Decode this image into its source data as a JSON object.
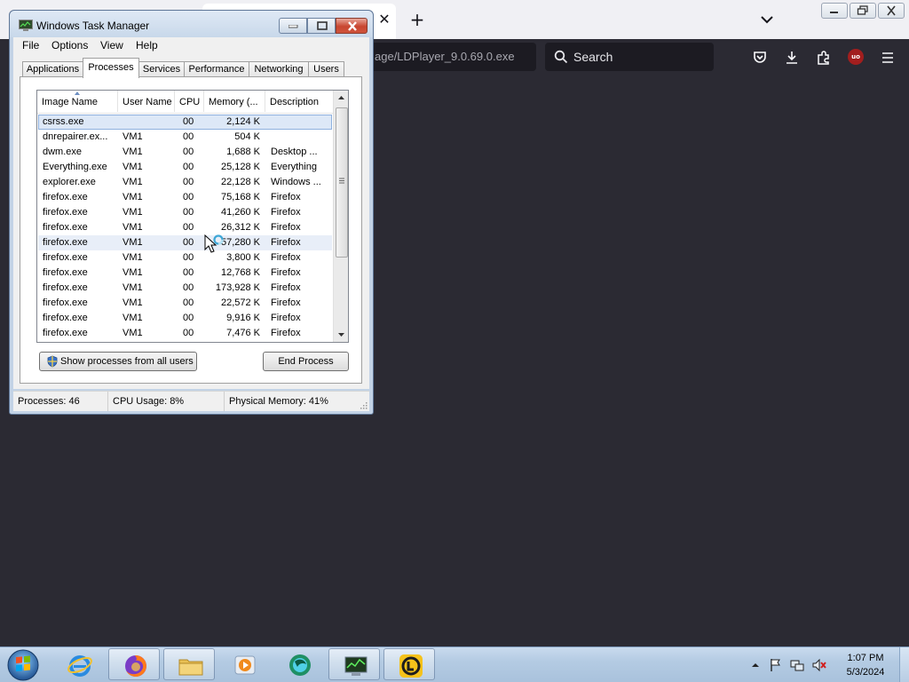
{
  "browser": {
    "tab_close_glyph": "✕",
    "new_tab_glyph": "+",
    "url_text": "age/LDPlayer_9.0.69.0.exe",
    "search_placeholder": "Search",
    "ublock_badge": "uo",
    "accent_bg": "#2b2a33"
  },
  "task_manager": {
    "title": "Windows Task Manager",
    "menu": [
      "File",
      "Options",
      "View",
      "Help"
    ],
    "tabs": [
      "Applications",
      "Processes",
      "Services",
      "Performance",
      "Networking",
      "Users"
    ],
    "active_tab": "Processes",
    "columns": [
      "Image Name",
      "User Name",
      "CPU",
      "Memory (...",
      "Description"
    ],
    "processes": [
      {
        "name": "csrss.exe",
        "user": "",
        "cpu": "00",
        "mem": "2,124 K",
        "desc": ""
      },
      {
        "name": "dnrepairer.ex...",
        "user": "VM1",
        "cpu": "00",
        "mem": "504 K",
        "desc": ""
      },
      {
        "name": "dwm.exe",
        "user": "VM1",
        "cpu": "00",
        "mem": "1,688 K",
        "desc": "Desktop ..."
      },
      {
        "name": "Everything.exe",
        "user": "VM1",
        "cpu": "00",
        "mem": "25,128 K",
        "desc": "Everything"
      },
      {
        "name": "explorer.exe",
        "user": "VM1",
        "cpu": "00",
        "mem": "22,128 K",
        "desc": "Windows ..."
      },
      {
        "name": "firefox.exe",
        "user": "VM1",
        "cpu": "00",
        "mem": "75,168 K",
        "desc": "Firefox"
      },
      {
        "name": "firefox.exe",
        "user": "VM1",
        "cpu": "00",
        "mem": "41,260 K",
        "desc": "Firefox"
      },
      {
        "name": "firefox.exe",
        "user": "VM1",
        "cpu": "00",
        "mem": "26,312 K",
        "desc": "Firefox"
      },
      {
        "name": "firefox.exe",
        "user": "VM1",
        "cpu": "00",
        "mem": "57,280 K",
        "desc": "Firefox"
      },
      {
        "name": "firefox.exe",
        "user": "VM1",
        "cpu": "00",
        "mem": "3,800 K",
        "desc": "Firefox"
      },
      {
        "name": "firefox.exe",
        "user": "VM1",
        "cpu": "00",
        "mem": "12,768 K",
        "desc": "Firefox"
      },
      {
        "name": "firefox.exe",
        "user": "VM1",
        "cpu": "00",
        "mem": "173,928 K",
        "desc": "Firefox"
      },
      {
        "name": "firefox.exe",
        "user": "VM1",
        "cpu": "00",
        "mem": "22,572 K",
        "desc": "Firefox"
      },
      {
        "name": "firefox.exe",
        "user": "VM1",
        "cpu": "00",
        "mem": "9,916 K",
        "desc": "Firefox"
      },
      {
        "name": "firefox.exe",
        "user": "VM1",
        "cpu": "00",
        "mem": "7,476 K",
        "desc": "Firefox"
      }
    ],
    "selected_row": 0,
    "hover_row": 8,
    "show_all_button": "Show processes from all users",
    "end_process_button": "End Process",
    "status": {
      "processes": "Processes: 46",
      "cpu": "CPU Usage: 8%",
      "memory": "Physical Memory: 41%"
    }
  },
  "taskbar": {
    "apps": [
      "internet-explorer",
      "firefox",
      "file-explorer",
      "media-player",
      "browser-app",
      "task-manager",
      "ldplayer"
    ],
    "clock_time": "1:07 PM",
    "clock_date": "5/3/2024"
  }
}
